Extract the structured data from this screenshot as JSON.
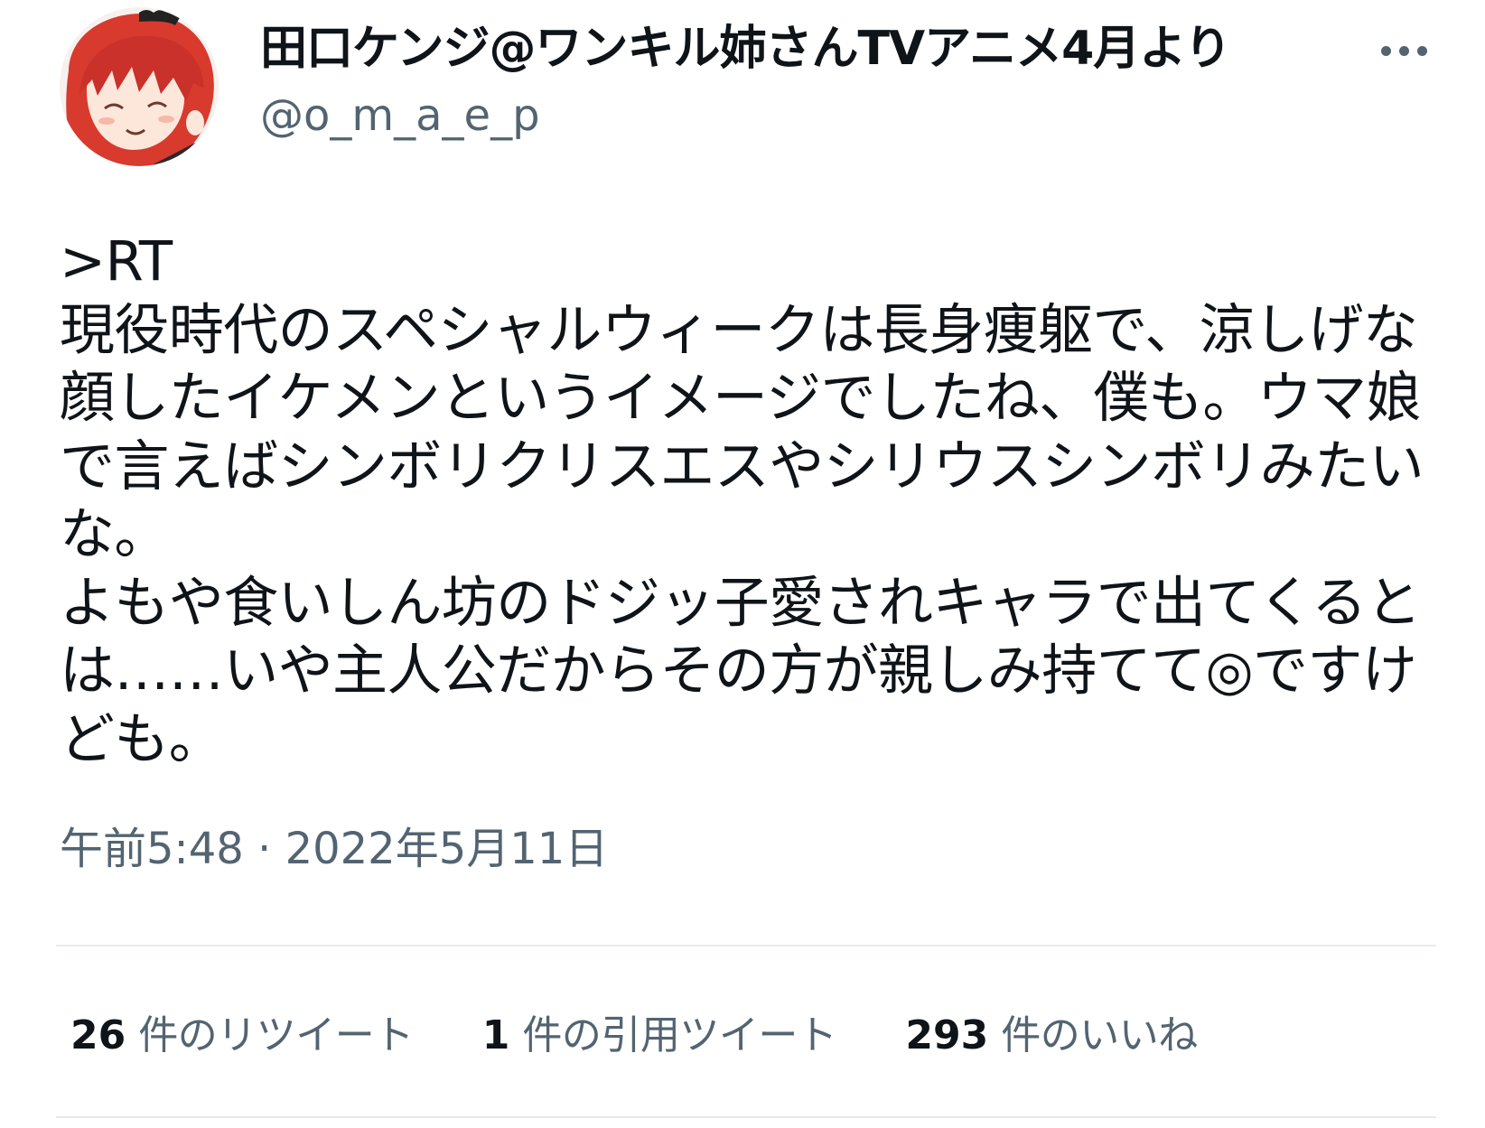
{
  "author": {
    "display_name": "田口ケンジ@ワンキル姉さんTVアニメ4月より",
    "handle": "@o_m_a_e_p"
  },
  "icons": {
    "avatar": "avatar-red-hair-character",
    "more": "more-horizontal-icon"
  },
  "tweet": {
    "text": ">RT\n現役時代のスペシャルウィークは長身痩躯で、涼しげな顔したイケメンというイメージでしたね、僕も。ウマ娘で言えばシンボリクリスエスやシリウスシンボリみたいな。\nよもや食いしん坊のドジッ子愛されキャラで出てくるとは……いや主人公だからその方が親しみ持てて◎ですけども。",
    "timestamp": "午前5:48 · 2022年5月11日"
  },
  "stats": {
    "retweets": {
      "count": "26",
      "label": "件のリツイート"
    },
    "quotes": {
      "count": "1",
      "label": "件の引用ツイート"
    },
    "likes": {
      "count": "293",
      "label": "件のいいね"
    }
  },
  "colors": {
    "text_primary": "#0f1419",
    "text_secondary": "#536471",
    "divider": "#e7eaed",
    "avatar_hair": "#d83a2e"
  }
}
